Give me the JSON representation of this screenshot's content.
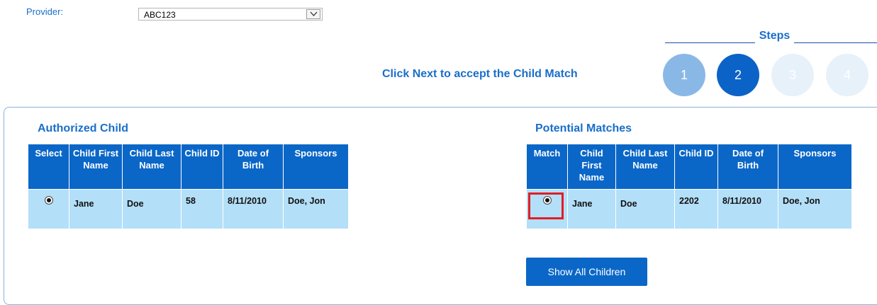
{
  "provider": {
    "label": "Provider:",
    "selected": "ABC123"
  },
  "steps": {
    "title": "Steps",
    "items": [
      {
        "label": "1",
        "state": "done"
      },
      {
        "label": "2",
        "state": "current"
      },
      {
        "label": "3",
        "state": "future"
      },
      {
        "label": "4",
        "state": "future"
      }
    ]
  },
  "instruction": "Click Next to accept the Child Match",
  "authorized": {
    "title": "Authorized Child",
    "headers": [
      "Select",
      "Child First Name",
      "Child Last Name",
      "Child ID",
      "Date of Birth",
      "Sponsors"
    ],
    "rows": [
      {
        "selected": true,
        "first": "Jane",
        "last": "Doe",
        "id": "58",
        "dob": "8/11/2010",
        "sponsors": "Doe, Jon"
      }
    ]
  },
  "matches": {
    "title": "Potential Matches",
    "headers": [
      "Match",
      "Child First Name",
      "Child Last Name",
      "Child ID",
      "Date of Birth",
      "Sponsors"
    ],
    "rows": [
      {
        "selected": true,
        "first": "Jane",
        "last": "Doe",
        "id": "2202",
        "dob": "8/11/2010",
        "sponsors": "Doe, Jon"
      }
    ]
  },
  "show_all_label": "Show All Children",
  "colors": {
    "accent": "#1a6ec9",
    "header_bg": "#0b67c7",
    "row_bg": "#b3dff8",
    "highlight": "#e01e25"
  }
}
